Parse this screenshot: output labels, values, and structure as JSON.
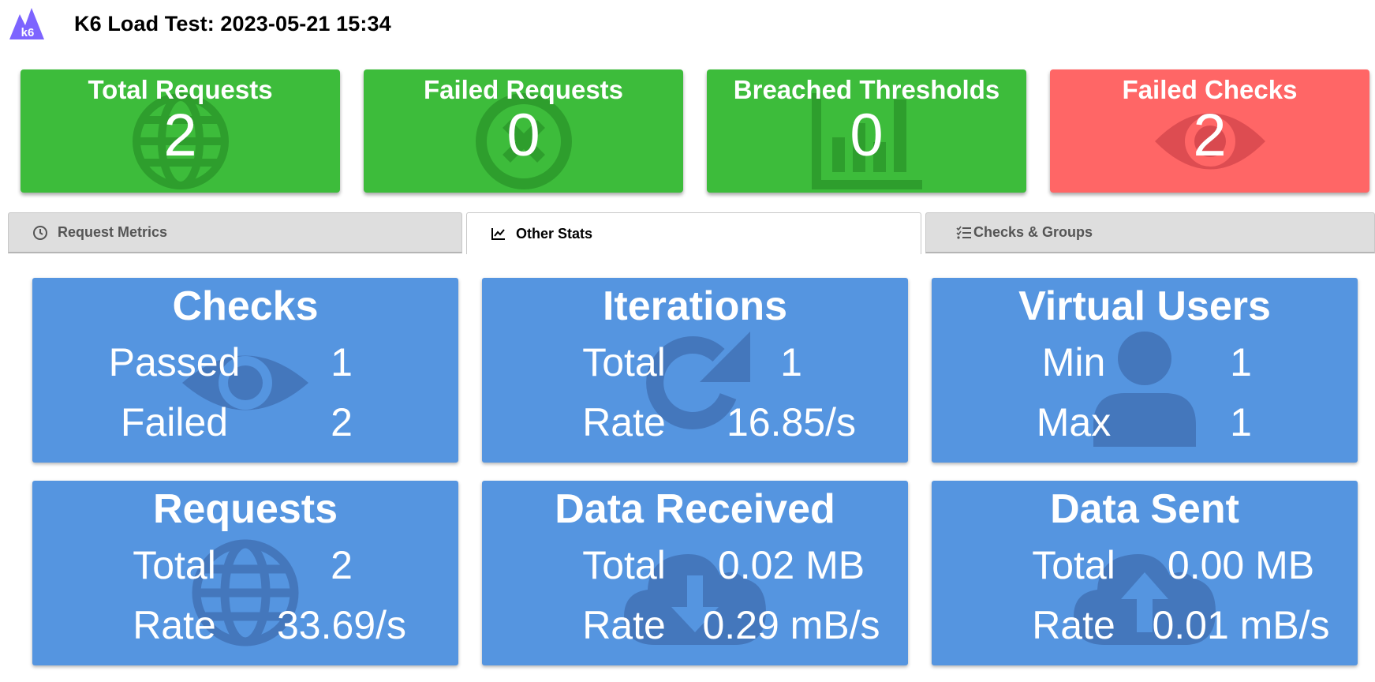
{
  "app": {
    "logo_text": "k6",
    "title": "K6 Load Test: 2023-05-21 15:34"
  },
  "summary": [
    {
      "title": "Total Requests",
      "value": "2",
      "icon": "globe-icon",
      "color": "#3dbc3b"
    },
    {
      "title": "Failed Requests",
      "value": "0",
      "icon": "x-circle-icon",
      "color": "#3dbc3b"
    },
    {
      "title": "Breached Thresholds",
      "value": "0",
      "icon": "bar-chart-icon",
      "color": "#3dbc3b"
    },
    {
      "title": "Failed Checks",
      "value": "2",
      "icon": "eye-icon",
      "color": "#ff6666"
    }
  ],
  "tabs": [
    {
      "label": "Request Metrics",
      "icon": "clock-icon",
      "active": false
    },
    {
      "label": "Other Stats",
      "icon": "line-chart-icon",
      "active": true
    },
    {
      "label": "Checks & Groups",
      "icon": "checklist-icon",
      "active": false
    }
  ],
  "cards": {
    "checks": {
      "title": "Checks",
      "icon": "eye-icon",
      "rows": [
        {
          "label": "Passed",
          "value": "1"
        },
        {
          "label": "Failed",
          "value": "2"
        }
      ]
    },
    "iterations": {
      "title": "Iterations",
      "icon": "redo-icon",
      "rows": [
        {
          "label": "Total",
          "value": "1"
        },
        {
          "label": "Rate",
          "value": "16.85/s"
        }
      ]
    },
    "vus": {
      "title": "Virtual Users",
      "icon": "user-icon",
      "rows": [
        {
          "label": "Min",
          "value": "1"
        },
        {
          "label": "Max",
          "value": "1"
        }
      ]
    },
    "requests": {
      "title": "Requests",
      "icon": "globe-icon",
      "rows": [
        {
          "label": "Total",
          "value": "2"
        },
        {
          "label": "Rate",
          "value": "33.69/s"
        }
      ]
    },
    "data_received": {
      "title": "Data Received",
      "icon": "cloud-download-icon",
      "rows": [
        {
          "label": "Total",
          "value": "0.02 MB"
        },
        {
          "label": "Rate",
          "value": "0.29 mB/s"
        }
      ]
    },
    "data_sent": {
      "title": "Data Sent",
      "icon": "cloud-upload-icon",
      "rows": [
        {
          "label": "Total",
          "value": "0.00 MB"
        },
        {
          "label": "Rate",
          "value": "0.01 mB/s"
        }
      ]
    }
  },
  "colors": {
    "accent_green": "#3dbc3b",
    "accent_red": "#ff6666",
    "card_blue": "#5595e0",
    "logo_purple": "#7d64ff"
  }
}
